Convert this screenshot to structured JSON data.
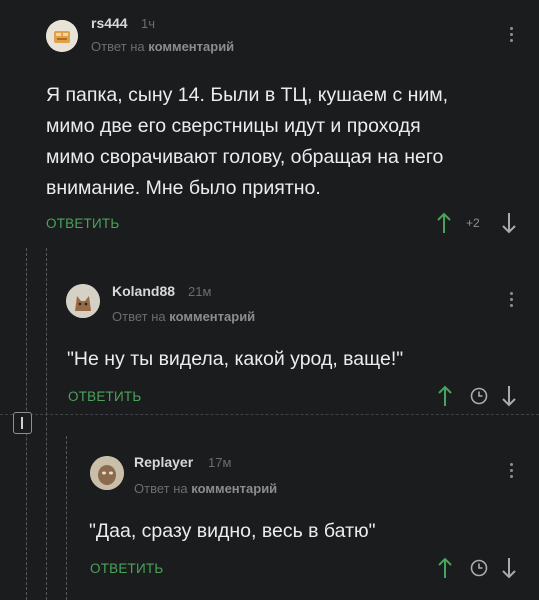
{
  "reply_prefix": "Ответ на",
  "reply_target": "комментарий",
  "reply_action": "ОТВЕТИТЬ",
  "colors": {
    "accent_green": "#49a35b",
    "muted": "#6b6d70",
    "background": "#1b1c1e"
  },
  "comments": [
    {
      "author": "rs444",
      "time": "1ч",
      "lines": [
        "Я папка,  сыну 14. Были в ТЦ,  кушаем с ним,",
        "мимо две его сверстницы идут и проходя",
        "мимо сворачивают голову,  обращая на него",
        "внимание.  Мне было приятно."
      ],
      "rating": "+2",
      "icons": [
        "upvote-icon",
        "downvote-icon",
        "more-icon"
      ]
    },
    {
      "author": "Koland88",
      "time": "21м",
      "lines": [
        "\"Не ну ты видела, какой урод, ваще!\""
      ],
      "icons": [
        "upvote-icon",
        "save-icon",
        "downvote-icon",
        "more-icon"
      ]
    },
    {
      "author": "Replayer",
      "time": "17м",
      "lines": [
        "\"Даа, сразу видно, весь в батю\""
      ],
      "icons": [
        "upvote-icon",
        "save-icon",
        "downvote-icon",
        "more-icon"
      ]
    }
  ]
}
